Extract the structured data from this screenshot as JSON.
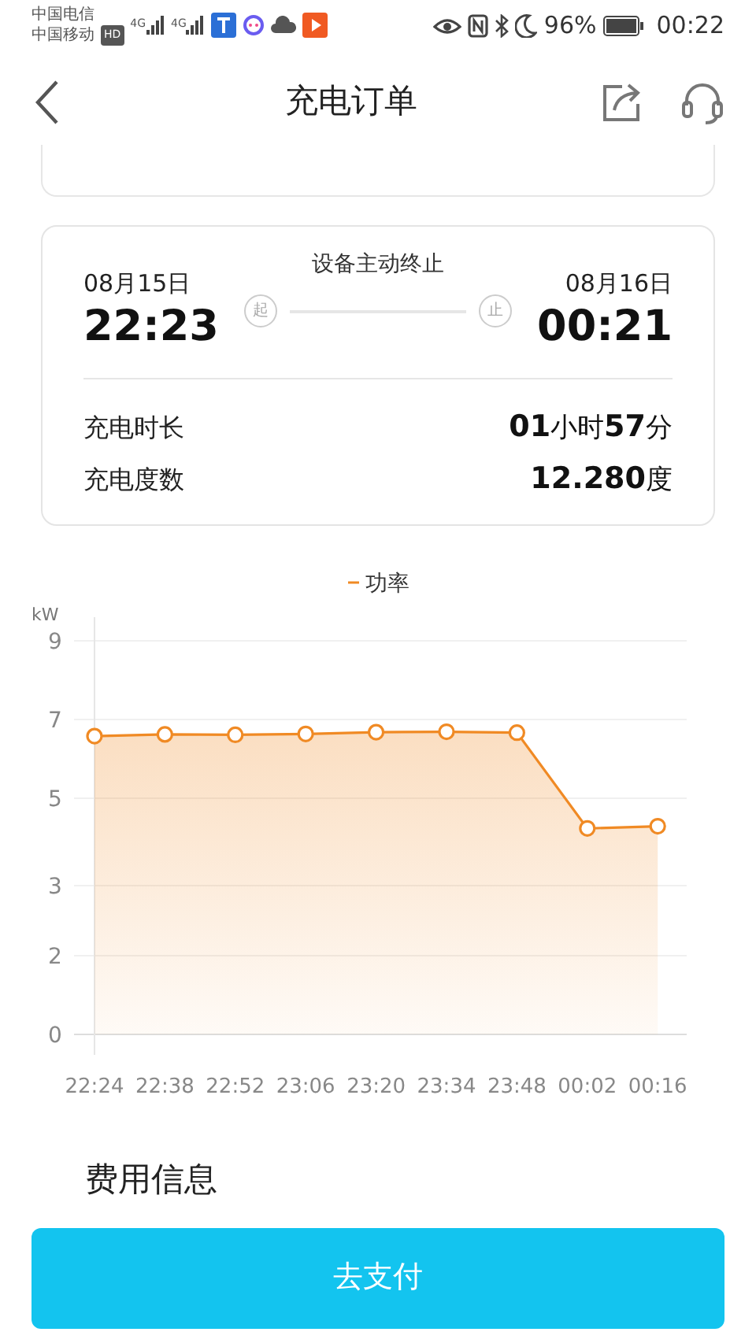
{
  "status_bar": {
    "carrier_1": "中国电信",
    "carrier_2": "中国移动",
    "hd_badge": "HD",
    "network_1": "4G",
    "network_2": "4G",
    "battery_percent": "96%",
    "time": "00:22"
  },
  "header": {
    "title": "充电订单"
  },
  "session": {
    "start_date": "08月15日",
    "start_time": "22:23",
    "start_mark": "起",
    "end_reason": "设备主动终止",
    "end_mark": "止",
    "end_date": "08月16日",
    "end_time": "00:21",
    "stats": [
      {
        "label": "充电时长",
        "value": "**01**小时**57**分"
      },
      {
        "label": "充电度数",
        "value": "**12.280**度"
      }
    ]
  },
  "power_chart": {
    "chart_data": {
      "type": "area",
      "ylabel": "kW",
      "categories": [
        "22:24",
        "22:38",
        "22:52",
        "23:06",
        "23:20",
        "23:34",
        "23:48",
        "00:02",
        "00:16"
      ],
      "series": [
        {
          "name": "功率",
          "color": "#f08a24",
          "values": [
            6.82,
            6.86,
            6.85,
            6.87,
            6.91,
            6.92,
            6.9,
            4.71,
            4.76
          ]
        }
      ],
      "ylim": [
        0,
        9
      ],
      "grid": true,
      "yticks": [
        {
          "value": 0,
          "label": "0"
        },
        {
          "value": 1.8,
          "label": "2"
        },
        {
          "value": 3.4,
          "label": "3"
        },
        {
          "value": 5.4,
          "label": "5"
        },
        {
          "value": 7.2,
          "label": "7"
        },
        {
          "value": 9,
          "label": "9"
        }
      ]
    }
  },
  "fee_section": {
    "title": "费用信息"
  },
  "pay_button": {
    "label": "去支付"
  }
}
